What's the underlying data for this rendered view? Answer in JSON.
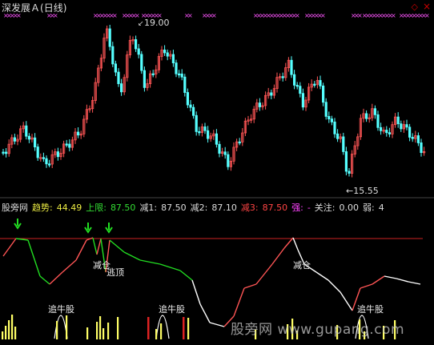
{
  "header": {
    "stock_name": "深发展Ａ",
    "period": "(日线)",
    "close_symbol": "×",
    "restore_symbol": "◇"
  },
  "price_chart": {
    "high_label": "19.00",
    "low_label": "←15.55"
  },
  "indicator": {
    "name": "股旁网",
    "trend_label": "趋势:",
    "trend_value": "44.49",
    "upper_label": "上限:",
    "upper_value": "87.50",
    "reduce1_label": "减1:",
    "reduce1_value": "87.50",
    "reduce2_label": "减2:",
    "reduce2_value": "87.10",
    "reduce3_label": "减3:",
    "reduce3_value": "87.50",
    "strong_label": "强:",
    "strong_value": "-",
    "follow_label": "关注:",
    "follow_value": "0.00",
    "weak_label": "弱:",
    "weak_value": "4"
  },
  "annotations": {
    "reduce": "减仓",
    "escape_top": "逃顶",
    "chase": "追牛股"
  },
  "watermark": "股旁网 www.gupang.com",
  "colors": {
    "bg": "#000000",
    "up": "#ff5555",
    "down": "#55ffff",
    "upper_line": "#cc2222",
    "signal": "#ff55ff",
    "arrow": "#22dd22",
    "yellow": "#ffff66",
    "white": "#ffffff"
  }
}
